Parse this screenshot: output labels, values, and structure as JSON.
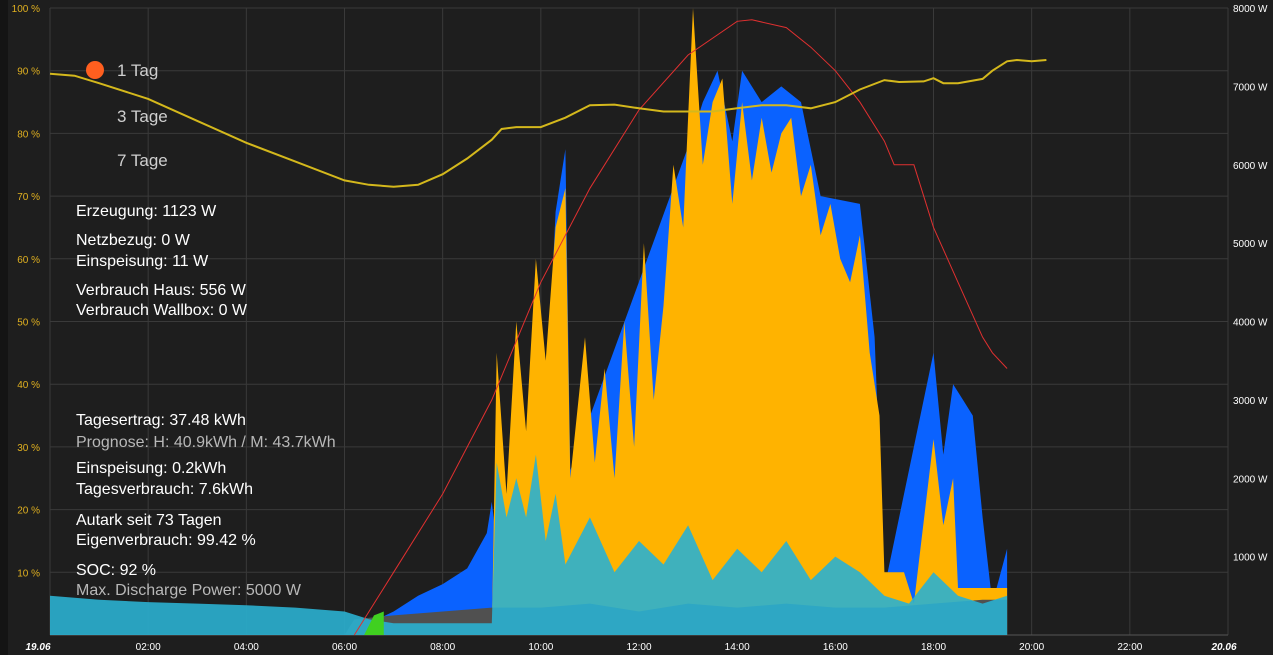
{
  "range_selector": {
    "options": [
      "1 Tag",
      "3 Tage",
      "7 Tage"
    ],
    "selected": 0
  },
  "stats": {
    "erzeugung": "Erzeugung: 1123 W",
    "netzbezug": "Netzbezug: 0 W",
    "einspeisung": "Einspeisung: 11 W",
    "verbrauch_haus": "Verbrauch Haus: 556 W",
    "verbrauch_wallbox": "Verbrauch Wallbox: 0 W",
    "tagesertrag": "Tagesertrag: 37.48 kWh",
    "prognose": "Prognose: H: 40.9kWh / M: 43.7kWh",
    "einspeisung_tag": "Einspeisung: 0.2kWh",
    "tagesverbrauch": "Tagesverbrauch: 7.6kWh",
    "autark": "Autark seit 73 Tagen",
    "eigenverbrauch": "Eigenverbrauch: 99.42 %",
    "soc": "SOC: 92 %",
    "max_discharge": "Max. Discharge Power: 5000 W"
  },
  "colors": {
    "background": "#1e1e1e",
    "grid": "#3a3a3a",
    "solar": "#ffb300",
    "battery_blue": "#0a62ff",
    "house_cyan": "#2ab0d0",
    "grid_gray": "#505050",
    "soc_line": "#d4b81c",
    "forecast_line": "#e03030",
    "green": "#40d020",
    "left_axis_text": "#e0b020",
    "right_axis_text": "#ffffff",
    "range_dot": "#ff5f1f"
  },
  "chart_data": {
    "type": "area",
    "x_ticks": [
      "19.06",
      "02:00",
      "04:00",
      "06:00",
      "08:00",
      "10:00",
      "12:00",
      "14:00",
      "16:00",
      "18:00",
      "20:00",
      "22:00",
      "20.06"
    ],
    "y_left": {
      "label": "",
      "ticks": [
        "10 %",
        "20 %",
        "30 %",
        "40 %",
        "50 %",
        "60 %",
        "70 %",
        "80 %",
        "90 %",
        "100 %"
      ],
      "ylim": [
        0,
        100
      ]
    },
    "y_right": {
      "label": "",
      "ticks": [
        "1000 W",
        "2000 W",
        "3000 W",
        "4000 W",
        "5000 W",
        "6000 W",
        "7000 W",
        "8000 W"
      ],
      "ylim": [
        0,
        8000
      ]
    },
    "xlim_hours": [
      0,
      24
    ],
    "grid": true,
    "series": [
      {
        "key": "soc",
        "axis": "left",
        "points": [
          [
            0,
            89.5
          ],
          [
            0.5,
            89.2
          ],
          [
            1,
            88
          ],
          [
            2,
            85.5
          ],
          [
            3,
            82
          ],
          [
            4,
            78.5
          ],
          [
            5,
            75.5
          ],
          [
            6,
            72.5
          ],
          [
            6.5,
            71.8
          ],
          [
            7,
            71.5
          ],
          [
            7.5,
            71.8
          ],
          [
            8,
            73.5
          ],
          [
            8.5,
            76
          ],
          [
            9,
            79
          ],
          [
            9.2,
            80.7
          ],
          [
            9.5,
            81
          ],
          [
            10,
            81
          ],
          [
            10.5,
            82.5
          ],
          [
            11,
            84.5
          ],
          [
            11.5,
            84.6
          ],
          [
            12,
            84
          ],
          [
            12.5,
            83.5
          ],
          [
            13,
            83.5
          ],
          [
            13.5,
            83.5
          ],
          [
            14,
            84
          ],
          [
            14.5,
            84.5
          ],
          [
            15,
            84.5
          ],
          [
            15.5,
            84
          ],
          [
            16,
            85
          ],
          [
            16.5,
            87
          ],
          [
            17,
            88.5
          ],
          [
            17.3,
            88.2
          ],
          [
            17.8,
            88.3
          ],
          [
            18,
            88.8
          ],
          [
            18.2,
            88
          ],
          [
            18.5,
            88
          ],
          [
            19,
            88.7
          ],
          [
            19.2,
            90
          ],
          [
            19.5,
            91.5
          ],
          [
            19.7,
            91.7
          ],
          [
            20,
            91.5
          ],
          [
            20.3,
            91.7
          ]
        ]
      },
      {
        "key": "forecast",
        "axis": "right",
        "points": [
          [
            6.2,
            0
          ],
          [
            7,
            800
          ],
          [
            8,
            1800
          ],
          [
            9,
            3000
          ],
          [
            10,
            4500
          ],
          [
            11,
            5700
          ],
          [
            12,
            6700
          ],
          [
            13,
            7400
          ],
          [
            14,
            7830
          ],
          [
            14.3,
            7850
          ],
          [
            15,
            7750
          ],
          [
            15.5,
            7500
          ],
          [
            16,
            7200
          ],
          [
            16.5,
            6800
          ],
          [
            17,
            6300
          ],
          [
            17.2,
            6000
          ],
          [
            17.6,
            6000
          ],
          [
            18,
            5200
          ],
          [
            18.5,
            4500
          ],
          [
            19,
            3800
          ],
          [
            19.2,
            3600
          ],
          [
            19.5,
            3400
          ]
        ]
      },
      {
        "key": "solar",
        "axis": "right",
        "points": [
          [
            9,
            0
          ],
          [
            9.1,
            3600
          ],
          [
            9.3,
            1800
          ],
          [
            9.5,
            4000
          ],
          [
            9.7,
            2600
          ],
          [
            9.9,
            4800
          ],
          [
            10.1,
            3500
          ],
          [
            10.3,
            5200
          ],
          [
            10.5,
            5700
          ],
          [
            10.6,
            2000
          ],
          [
            10.9,
            3800
          ],
          [
            11.1,
            2200
          ],
          [
            11.3,
            3400
          ],
          [
            11.5,
            2000
          ],
          [
            11.7,
            4000
          ],
          [
            11.9,
            2400
          ],
          [
            12.1,
            5000
          ],
          [
            12.3,
            3000
          ],
          [
            12.5,
            4200
          ],
          [
            12.7,
            6000
          ],
          [
            12.9,
            5200
          ],
          [
            13.1,
            8000
          ],
          [
            13.3,
            6000
          ],
          [
            13.5,
            6800
          ],
          [
            13.7,
            7100
          ],
          [
            13.9,
            5500
          ],
          [
            14.1,
            6800
          ],
          [
            14.3,
            5800
          ],
          [
            14.5,
            6600
          ],
          [
            14.7,
            5900
          ],
          [
            14.9,
            6400
          ],
          [
            15.1,
            6600
          ],
          [
            15.3,
            5600
          ],
          [
            15.5,
            6000
          ],
          [
            15.7,
            5100
          ],
          [
            15.9,
            5500
          ],
          [
            16.1,
            4800
          ],
          [
            16.3,
            4500
          ],
          [
            16.5,
            5100
          ],
          [
            16.7,
            3600
          ],
          [
            16.9,
            2800
          ],
          [
            17,
            800
          ],
          [
            17.4,
            800
          ],
          [
            17.6,
            400
          ],
          [
            18,
            2500
          ],
          [
            18.2,
            1400
          ],
          [
            18.4,
            2000
          ],
          [
            18.5,
            600
          ],
          [
            19.5,
            600
          ]
        ]
      },
      {
        "key": "battery",
        "axis": "right",
        "points": [
          [
            6.5,
            150
          ],
          [
            7,
            300
          ],
          [
            7.5,
            500
          ],
          [
            8,
            650
          ],
          [
            8.5,
            850
          ],
          [
            8.9,
            1300
          ],
          [
            9,
            1700
          ],
          [
            9.2,
            600
          ],
          [
            10.1,
            2800
          ],
          [
            10.3,
            5400
          ],
          [
            10.5,
            6200
          ],
          [
            10.6,
            2100
          ],
          [
            13.1,
            6400
          ],
          [
            13.3,
            6800
          ],
          [
            13.6,
            7200
          ],
          [
            13.9,
            6300
          ],
          [
            14.1,
            7200
          ],
          [
            14.5,
            6800
          ],
          [
            14.9,
            7000
          ],
          [
            15.3,
            6800
          ],
          [
            15.7,
            5600
          ],
          [
            16.5,
            5500
          ],
          [
            16.8,
            3800
          ],
          [
            17,
            600
          ],
          [
            18.0,
            3600
          ],
          [
            18.2,
            2300
          ],
          [
            18.4,
            3200
          ],
          [
            18.6,
            3000
          ],
          [
            18.8,
            2800
          ],
          [
            19,
            1500
          ],
          [
            19.2,
            400
          ],
          [
            19.5,
            1100
          ]
        ]
      },
      {
        "key": "house",
        "axis": "right",
        "points": [
          [
            0,
            500
          ],
          [
            1,
            450
          ],
          [
            2,
            420
          ],
          [
            3,
            400
          ],
          [
            4,
            380
          ],
          [
            5,
            350
          ],
          [
            6,
            300
          ],
          [
            6.5,
            200
          ],
          [
            7,
            150
          ],
          [
            8,
            150
          ],
          [
            9,
            150
          ],
          [
            9.1,
            2200
          ],
          [
            9.3,
            1500
          ],
          [
            9.5,
            2000
          ],
          [
            9.7,
            1500
          ],
          [
            9.9,
            2300
          ],
          [
            10.1,
            1200
          ],
          [
            10.3,
            1800
          ],
          [
            10.5,
            900
          ],
          [
            11,
            1500
          ],
          [
            11.5,
            800
          ],
          [
            12,
            1200
          ],
          [
            12.5,
            900
          ],
          [
            13,
            1400
          ],
          [
            13.5,
            700
          ],
          [
            14,
            1100
          ],
          [
            14.5,
            800
          ],
          [
            15,
            1200
          ],
          [
            15.5,
            700
          ],
          [
            16,
            1000
          ],
          [
            16.5,
            800
          ],
          [
            17,
            500
          ],
          [
            17.5,
            400
          ],
          [
            18,
            800
          ],
          [
            18.5,
            500
          ],
          [
            19,
            400
          ],
          [
            19.5,
            500
          ]
        ]
      },
      {
        "key": "gridload",
        "axis": "right",
        "points": [
          [
            6,
            0
          ],
          [
            6.2,
            200
          ],
          [
            7,
            250
          ],
          [
            8,
            300
          ],
          [
            9,
            350
          ],
          [
            10,
            350
          ],
          [
            11,
            400
          ],
          [
            12,
            300
          ],
          [
            13,
            400
          ],
          [
            14,
            350
          ],
          [
            15,
            400
          ],
          [
            16,
            350
          ],
          [
            17,
            350
          ],
          [
            18,
            400
          ],
          [
            19,
            450
          ],
          [
            19.5,
            450
          ]
        ]
      }
    ]
  }
}
